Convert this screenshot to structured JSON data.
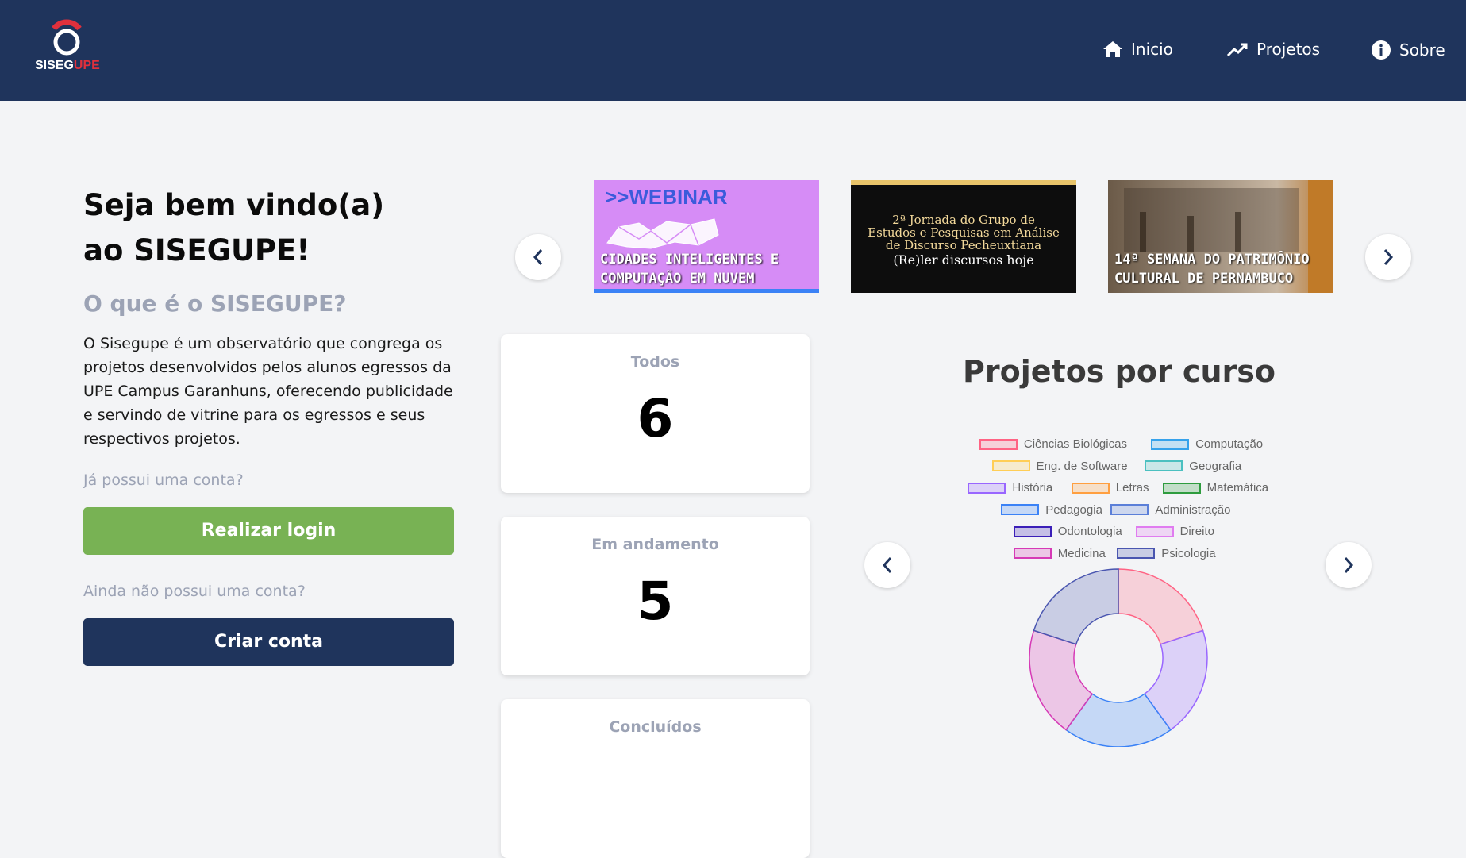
{
  "header": {
    "logo_text_main": "SISEG",
    "logo_text_accent": "UPE",
    "nav": [
      {
        "label": "Inicio",
        "icon": "home-icon"
      },
      {
        "label": "Projetos",
        "icon": "trending-icon"
      },
      {
        "label": "Sobre",
        "icon": "info-icon"
      }
    ]
  },
  "intro": {
    "welcome": "Seja bem vindo(a) ao SISEGUPE!",
    "what_is_title": "O que é o SISEGUPE?",
    "description": "O Sisegupe é um observatório que congrega os projetos desenvolvidos pelos alunos egressos da UPE Campus Garanhuns, oferecendo publicidade e servindo de vitrine para os egressos e seus respectivos projetos.",
    "has_account": "Já possui uma conta?",
    "login_button": "Realizar login",
    "no_account": "Ainda não possui uma conta?",
    "create_button": "Criar conta"
  },
  "carousel": {
    "banners": [
      {
        "tag": ">>WEBINAR",
        "line1": "CIDADES INTELIGENTES E",
        "line2": "COMPUTAÇÃO EM NUVEM"
      },
      {
        "line1": "2ª Jornada do Grupo de",
        "line2": "Estudos e Pesquisas em Análise",
        "line3": "de Discurso Pecheuxtiana",
        "line4": "(Re)ler discursos hoje"
      },
      {
        "line1": "14ª SEMANA DO PATRIMÔNIO",
        "line2": "CULTURAL DE PERNAMBUCO"
      }
    ]
  },
  "stats": [
    {
      "label": "Todos",
      "value": "6"
    },
    {
      "label": "Em andamento",
      "value": "5"
    },
    {
      "label": "Concluídos",
      "value": ""
    }
  ],
  "colors": {
    "header": "#1f345c",
    "login": "#78b254",
    "create": "#1f345c",
    "muted": "#9ca3b5"
  },
  "chart_data": {
    "type": "pie",
    "title": "Projetos por curso",
    "legend_position": "top",
    "categories": [
      "Ciências Biológicas",
      "Computação",
      "Eng. de Software",
      "Geografia",
      "História",
      "Letras",
      "Matemática",
      "Pedagogia",
      "Administração",
      "Odontologia",
      "Direito",
      "Medicina",
      "Psicologia"
    ],
    "colors": [
      "#ff6384",
      "#36a2eb",
      "#ffce56",
      "#4bc0c0",
      "#9966ff",
      "#ff9f40",
      "#2e9c3e",
      "#3b82f6",
      "#5b7fd8",
      "#3b1fb8",
      "#e07cf0",
      "#d63ab6",
      "#4a56b0"
    ],
    "values": [
      1,
      1,
      0,
      0,
      1,
      0,
      0,
      1,
      0,
      0,
      0,
      1,
      1
    ],
    "ring_order": [
      "Ciências Biológicas",
      "Eng. de Software",
      "História",
      "Pedagogia",
      "Medicina",
      "Psicologia"
    ]
  }
}
